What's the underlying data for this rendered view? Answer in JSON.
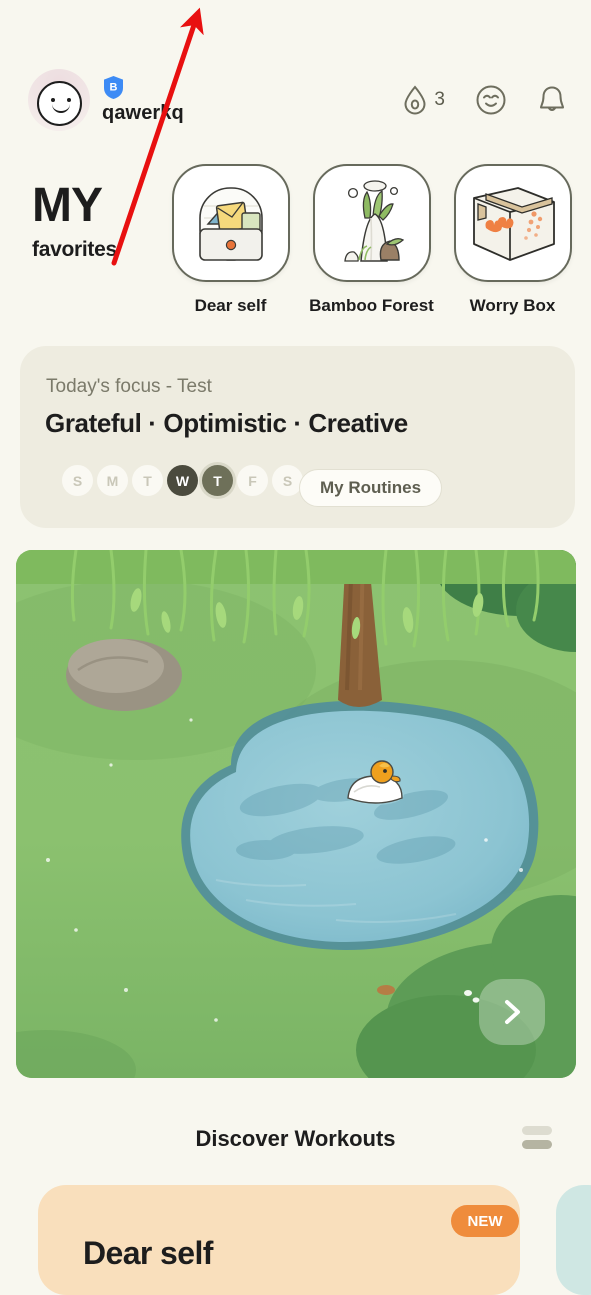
{
  "app": {
    "background_color": "#f8f7ef"
  },
  "header": {
    "avatar": {
      "icon": "smiley-avatar-icon",
      "bg_color": "#f1e6e6"
    },
    "badge": {
      "icon": "shield-badge-icon",
      "letter": "B",
      "color": "#3d8bf5"
    },
    "username": "qawerkq",
    "actions": [
      {
        "icon": "water-drop-icon",
        "value": "3"
      },
      {
        "icon": "calm-face-icon",
        "value": ""
      },
      {
        "icon": "bell-icon",
        "value": ""
      }
    ]
  },
  "favorites": {
    "title_line1": "MY",
    "title_line2": "favorites",
    "items": [
      {
        "label": "Dear self",
        "icon": "mailbox-icon"
      },
      {
        "label": "Bamboo Forest",
        "icon": "bamboo-plant-icon"
      },
      {
        "label": "Worry Box",
        "icon": "cardboard-box-icon"
      }
    ]
  },
  "focus": {
    "subtitle": "Today's focus - Test",
    "keywords": "Grateful · Optimistic · Creative",
    "days": [
      {
        "label": "S",
        "state": "inactive"
      },
      {
        "label": "M",
        "state": "inactive"
      },
      {
        "label": "T",
        "state": "inactive"
      },
      {
        "label": "W",
        "state": "active-dark"
      },
      {
        "label": "T",
        "state": "active-mid"
      },
      {
        "label": "F",
        "state": "inactive"
      },
      {
        "label": "S",
        "state": "inactive"
      }
    ],
    "routines_button": "My Routines",
    "card_color": "#eeece0",
    "day_active_dark_color": "#4b4b3e",
    "day_active_mid_color": "#6e7059"
  },
  "scene": {
    "name": "pond-scene",
    "next_button_icon": "chevron-right-icon",
    "elements": [
      "grass",
      "pond",
      "willow-tree",
      "rock",
      "duck"
    ],
    "grass_color": "#86bd6b",
    "water_color": "#8fc7d4"
  },
  "discover": {
    "title": "Discover Workouts",
    "list_icon": "list-view-icon",
    "cards": [
      {
        "title": "Dear self",
        "badge": "NEW",
        "color": "#f9dfbc",
        "badge_color": "#ef8c3c"
      },
      {
        "title": "",
        "badge": "",
        "color": "#cfe7e3",
        "badge_color": ""
      }
    ]
  },
  "annotation": {
    "type": "arrow",
    "color": "#e81010",
    "from": "115,262",
    "to": "196,16"
  }
}
